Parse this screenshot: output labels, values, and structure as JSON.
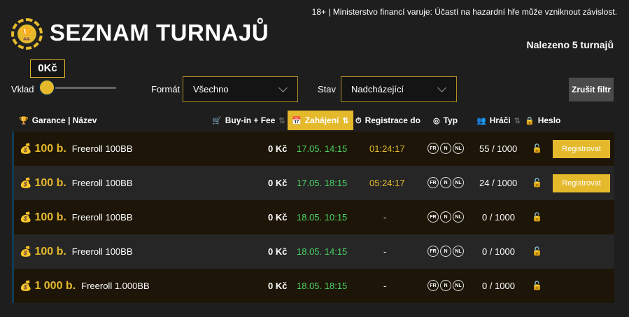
{
  "header": {
    "warning": "18+ | Ministerstvo financí varuje: Účastí na hazardní hře může vzniknout závislost.",
    "title": "SEZNAM TURNAJŮ",
    "found": "Nalezeno 5 turnajů"
  },
  "filters": {
    "vklad_label": "Vklad",
    "vklad_value": "0Kč",
    "format_label": "Formát",
    "format_value": "Všechno",
    "stav_label": "Stav",
    "stav_value": "Nadcházející",
    "reset_label": "Zrušit filtr"
  },
  "table": {
    "headers": {
      "guarantee": "Garance | Název",
      "buyin": "Buy-in + Fee",
      "start": "Zahájení",
      "registration": "Registrace do",
      "type": "Typ",
      "players": "Hráči",
      "password": "Heslo"
    },
    "register_label": "Registrovat",
    "type_badges": [
      "FR",
      "N",
      "NL"
    ],
    "rows": [
      {
        "guarantee": "100 b.",
        "name": "Freeroll 100BB",
        "buyin": "0 Kč",
        "start": "17.05. 14:15",
        "registration": "01:24:17",
        "players": "55 / 1000",
        "can_register": true
      },
      {
        "guarantee": "100 b.",
        "name": "Freeroll 100BB",
        "buyin": "0 Kč",
        "start": "17.05. 18:15",
        "registration": "05:24:17",
        "players": "24 / 1000",
        "can_register": true
      },
      {
        "guarantee": "100 b.",
        "name": "Freeroll 100BB",
        "buyin": "0 Kč",
        "start": "18.05. 10:15",
        "registration": "-",
        "players": "0 / 1000",
        "can_register": false
      },
      {
        "guarantee": "100 b.",
        "name": "Freeroll 100BB",
        "buyin": "0 Kč",
        "start": "18.05. 14:15",
        "registration": "-",
        "players": "0 / 1000",
        "can_register": false
      },
      {
        "guarantee": "1 000 b.",
        "name": "Freeroll 1.000BB",
        "buyin": "0 Kč",
        "start": "18.05. 18:15",
        "registration": "-",
        "players": "0 / 1000",
        "can_register": false
      }
    ]
  },
  "colors": {
    "accent": "#e5b92c",
    "start_time": "#4cd264",
    "row_border": "#0f3c55"
  }
}
